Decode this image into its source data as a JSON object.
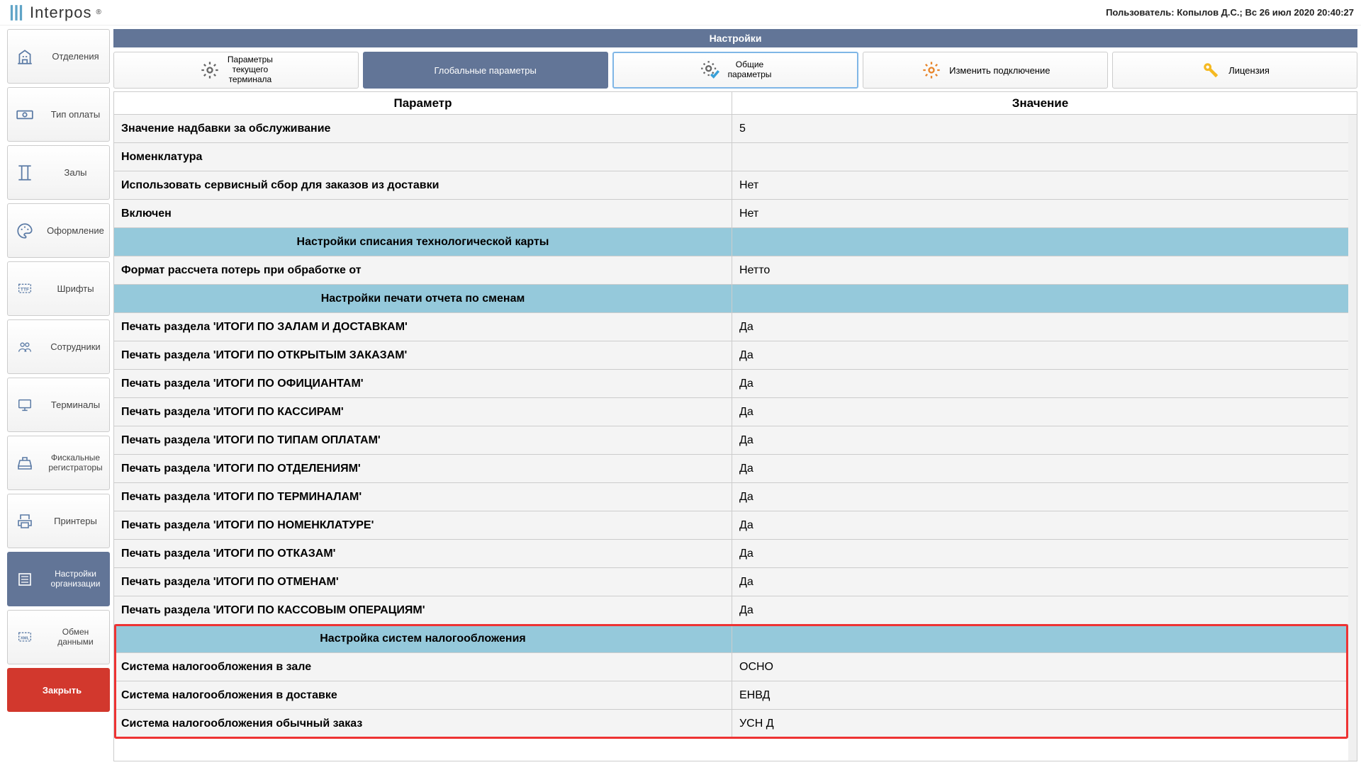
{
  "header": {
    "appname": "Interpos",
    "userinfo": "Пользователь: Копылов Д.С.; Вс 26 июл 2020 20:40:27"
  },
  "sidebar": {
    "items": [
      {
        "label": "Отделения"
      },
      {
        "label": "Тип оплаты"
      },
      {
        "label": "Залы"
      },
      {
        "label": "Оформление"
      },
      {
        "label": "Шрифты"
      },
      {
        "label": "Сотрудники"
      },
      {
        "label": "Терминалы"
      },
      {
        "label": "Фискальные\nрегистраторы"
      },
      {
        "label": "Принтеры"
      },
      {
        "label": "Настройки\nорганизации"
      },
      {
        "label": "Обмен\nданными"
      }
    ],
    "close": "Закрыть"
  },
  "main": {
    "title": "Настройки",
    "tabs": [
      {
        "label": "Параметры\nтекущего\nтерминала"
      },
      {
        "label": "Глобальные параметры"
      },
      {
        "label": "Общие\nпараметры"
      },
      {
        "label": "Изменить подключение"
      },
      {
        "label": "Лицензия"
      }
    ],
    "columns": {
      "param": "Параметр",
      "value": "Значение"
    },
    "rows": [
      {
        "type": "normal",
        "param": "Значение надбавки за обслуживание",
        "value": "5"
      },
      {
        "type": "normal",
        "param": "Номенклатура",
        "value": ""
      },
      {
        "type": "normal",
        "param": "Использовать сервисный сбор для заказов из доставки",
        "value": "Нет"
      },
      {
        "type": "normal",
        "param": "Включен",
        "value": "Нет"
      },
      {
        "type": "section",
        "param": "Настройки списания технологической карты",
        "value": ""
      },
      {
        "type": "normal",
        "param": "Формат рассчета потерь при обработке от",
        "value": "Нетто"
      },
      {
        "type": "section",
        "param": "Настройки печати отчета по сменам",
        "value": ""
      },
      {
        "type": "normal",
        "param": "Печать раздела 'ИТОГИ ПО ЗАЛАМ И ДОСТАВКАМ'",
        "value": "Да"
      },
      {
        "type": "normal",
        "param": "Печать раздела 'ИТОГИ ПО ОТКРЫТЫМ ЗАКАЗАМ'",
        "value": "Да"
      },
      {
        "type": "normal",
        "param": "Печать раздела 'ИТОГИ ПО ОФИЦИАНТАМ'",
        "value": "Да"
      },
      {
        "type": "normal",
        "param": "Печать раздела 'ИТОГИ ПО КАССИРАМ'",
        "value": "Да"
      },
      {
        "type": "normal",
        "param": "Печать раздела 'ИТОГИ ПО ТИПАМ ОПЛАТАМ'",
        "value": "Да"
      },
      {
        "type": "normal",
        "param": "Печать раздела 'ИТОГИ ПО ОТДЕЛЕНИЯМ'",
        "value": "Да"
      },
      {
        "type": "normal",
        "param": "Печать раздела 'ИТОГИ ПО ТЕРМИНАЛАМ'",
        "value": "Да"
      },
      {
        "type": "normal",
        "param": "Печать раздела 'ИТОГИ ПО НОМЕНКЛАТУРЕ'",
        "value": "Да"
      },
      {
        "type": "normal",
        "param": "Печать раздела 'ИТОГИ ПО ОТКАЗАМ'",
        "value": "Да"
      },
      {
        "type": "normal",
        "param": "Печать раздела 'ИТОГИ ПО ОТМЕНАМ'",
        "value": "Да"
      },
      {
        "type": "normal",
        "param": "Печать раздела 'ИТОГИ ПО КАССОВЫМ ОПЕРАЦИЯМ'",
        "value": "Да"
      },
      {
        "type": "section",
        "param": "Настройка систем налогообложения",
        "value": ""
      },
      {
        "type": "normal",
        "param": "Система налогообложения в зале",
        "value": "ОСНО"
      },
      {
        "type": "normal",
        "param": "Система налогообложения в доставке",
        "value": "ЕНВД"
      },
      {
        "type": "normal",
        "param": "Система налогообложения обычный заказ",
        "value": "УСН Д"
      }
    ]
  }
}
